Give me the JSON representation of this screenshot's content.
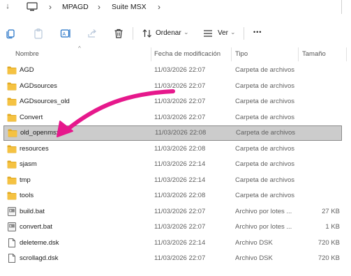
{
  "breadcrumb": {
    "items": [
      "MPAGD",
      "Suite MSX"
    ]
  },
  "toolbar": {
    "sort_label": "Ordenar",
    "view_label": "Ver",
    "more_label": "•••"
  },
  "columns": {
    "name": "Nombre",
    "modified": "Fecha de modificación",
    "type": "Tipo",
    "size": "Tamaño"
  },
  "files": [
    {
      "name": "AGD",
      "date": "11/03/2026 22:07",
      "type": "Carpeta de archivos",
      "size": "",
      "icon": "folder-icon"
    },
    {
      "name": "AGDsources",
      "date": "11/03/2026 22:07",
      "type": "Carpeta de archivos",
      "size": "",
      "icon": "folder-icon"
    },
    {
      "name": "AGDsources_old",
      "date": "11/03/2026 22:07",
      "type": "Carpeta de archivos",
      "size": "",
      "icon": "folder-icon"
    },
    {
      "name": "Convert",
      "date": "11/03/2026 22:07",
      "type": "Carpeta de archivos",
      "size": "",
      "icon": "folder-icon"
    },
    {
      "name": "old_openmsx",
      "date": "11/03/2026 22:08",
      "type": "Carpeta de archivos",
      "size": "",
      "icon": "folder-icon",
      "selected": true
    },
    {
      "name": "resources",
      "date": "11/03/2026 22:08",
      "type": "Carpeta de archivos",
      "size": "",
      "icon": "folder-icon"
    },
    {
      "name": "sjasm",
      "date": "11/03/2026 22:14",
      "type": "Carpeta de archivos",
      "size": "",
      "icon": "folder-icon"
    },
    {
      "name": "tmp",
      "date": "11/03/2026 22:14",
      "type": "Carpeta de archivos",
      "size": "",
      "icon": "folder-icon"
    },
    {
      "name": "tools",
      "date": "11/03/2026 22:08",
      "type": "Carpeta de archivos",
      "size": "",
      "icon": "folder-icon"
    },
    {
      "name": "build.bat",
      "date": "11/03/2026 22:07",
      "type": "Archivo por lotes ...",
      "size": "27 KB",
      "icon": "batch-file-icon"
    },
    {
      "name": "convert.bat",
      "date": "11/03/2026 22:07",
      "type": "Archivo por lotes ...",
      "size": "1 KB",
      "icon": "batch-file-icon"
    },
    {
      "name": "deleteme.dsk",
      "date": "11/03/2026 22:14",
      "type": "Archivo DSK",
      "size": "720 KB",
      "icon": "file-icon"
    },
    {
      "name": "scrollagd.dsk",
      "date": "11/03/2026 22:07",
      "type": "Archivo DSK",
      "size": "720 KB",
      "icon": "file-icon"
    }
  ],
  "colors": {
    "folder": "#f5c242",
    "folder_dark": "#e0a820",
    "annotation_arrow": "#e6188c",
    "selection": "#cccccc",
    "accent": "#0067c0"
  }
}
